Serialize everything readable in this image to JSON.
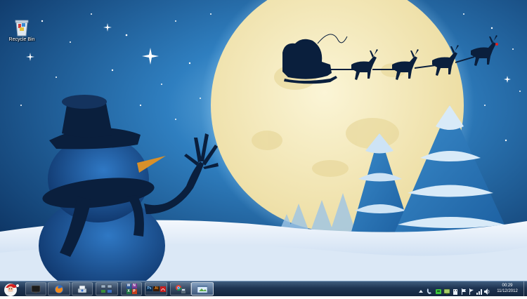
{
  "desktop": {
    "icons": [
      {
        "label": "Recycle Bin",
        "icon": "recycle-bin-icon"
      }
    ]
  },
  "taskbar": {
    "start": {
      "icon": "santa-start-orb-icon"
    },
    "buttons": [
      {
        "icon": "media-center-icon",
        "state": "pinned"
      },
      {
        "icon": "firefox-icon",
        "state": "pinned"
      },
      {
        "icon": "computer-scanner-icon",
        "state": "pinned"
      },
      {
        "icon": "network-tools-icon",
        "state": "pinned"
      },
      {
        "icon": "office-apps-icon",
        "letters": [
          "W",
          "N",
          "X",
          "P"
        ],
        "state": "pinned"
      },
      {
        "icon": "adobe-apps-icon",
        "letters": [
          "Ps",
          "Ai"
        ],
        "state": "pinned"
      },
      {
        "icon": "chrome-tools-icon",
        "state": "pinned"
      },
      {
        "icon": "desktop-window-icon",
        "state": "active"
      }
    ],
    "tray": {
      "icons": [
        "show-hidden-icons-arrow",
        "phone-link-icon",
        "green-app-icon",
        "network-icon",
        "usb-icon",
        "action-center-flag-icon",
        "flag-icon",
        "signal-icon",
        "volume-icon"
      ],
      "time": "00:29",
      "date": "11/12/2012"
    }
  },
  "colors": {
    "sky_dark": "#103a6b",
    "sky_light": "#2f7fc0",
    "moon": "#f6edc0",
    "snow": "#e8f1fb",
    "silhouette": "#0a1f3d",
    "taskbar": "#1e3452"
  }
}
